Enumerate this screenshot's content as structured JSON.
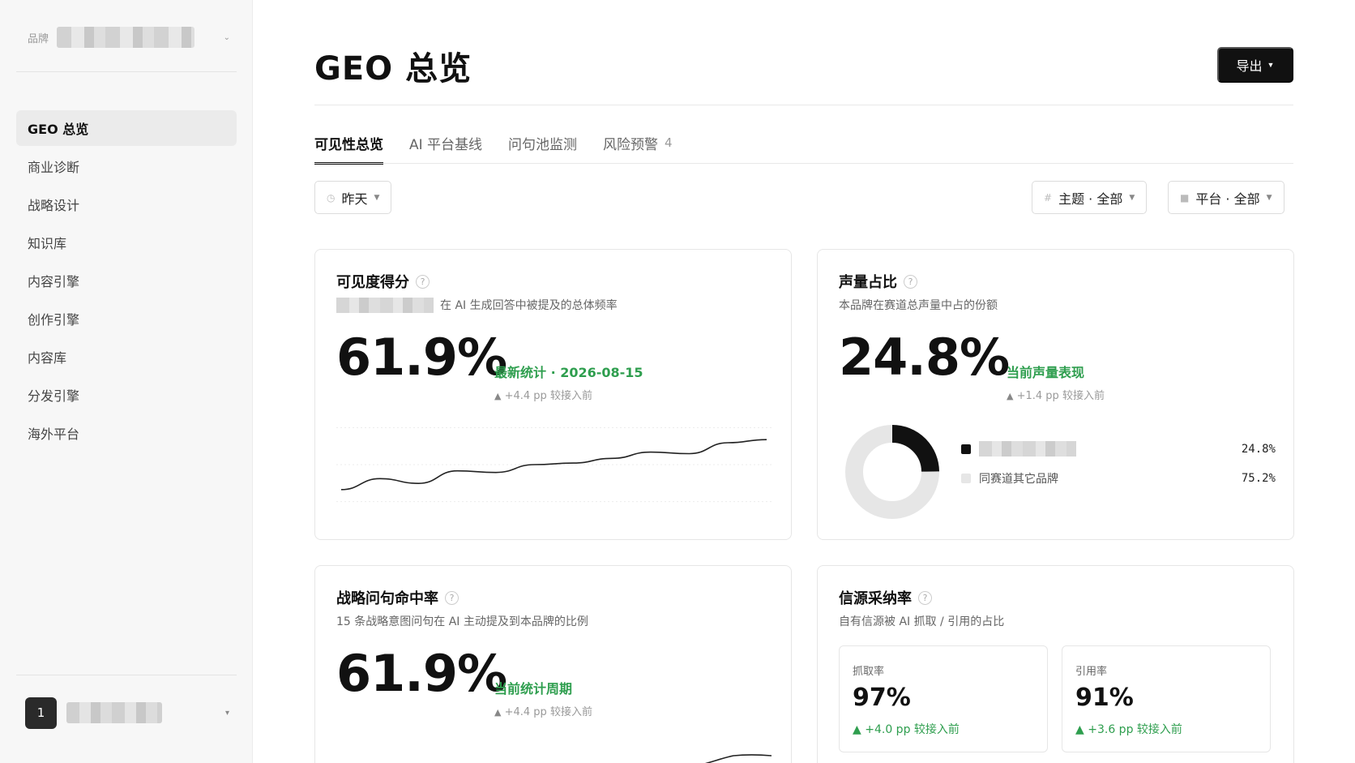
{
  "sidebar": {
    "brand_label": "品牌",
    "nav": [
      {
        "label": "GEO 总览",
        "active": true
      },
      {
        "label": "商业诊断",
        "active": false
      },
      {
        "label": "战略设计",
        "active": false
      },
      {
        "label": "知识库",
        "active": false
      },
      {
        "label": "内容引擎",
        "active": false
      },
      {
        "label": "创作引擎",
        "active": false
      },
      {
        "label": "内容库",
        "active": false
      },
      {
        "label": "分发引擎",
        "active": false
      },
      {
        "label": "海外平台",
        "active": false
      }
    ],
    "user_avatar": "1"
  },
  "header": {
    "title": "GEO 总览",
    "export_label": "导出"
  },
  "tabs": [
    {
      "label": "可见性总览",
      "active": true
    },
    {
      "label": "AI 平台基线",
      "active": false
    },
    {
      "label": "问句池监测",
      "active": false
    },
    {
      "label": "风险预警",
      "active": false,
      "count": "4"
    }
  ],
  "filters": {
    "date": "昨天",
    "topic": "主题 · 全部",
    "platform": "平台 · 全部"
  },
  "cards": {
    "visibility": {
      "title": "可见度得分",
      "subtitle": "在 AI 生成回答中被提及的总体频率",
      "value": "61.9%",
      "note": "最新统计 · 2026-08-15",
      "delta": "+4.4 pp 较接入前"
    },
    "share_of_voice": {
      "title": "声量占比",
      "subtitle": "本品牌在赛道总声量中占的份额",
      "value": "24.8%",
      "note": "当前声量表现",
      "delta": "+1.4 pp 较接入前",
      "legend": [
        {
          "label": "",
          "pct": "24.8%",
          "color": "#111111"
        },
        {
          "label": "同赛道其它品牌",
          "pct": "75.2%",
          "color": "#e6e6e6"
        }
      ]
    },
    "strategy_hit": {
      "title": "战略问句命中率",
      "subtitle": "15 条战略意图问句在 AI 主动提及到本品牌的比例",
      "value": "61.9%",
      "note": "当前统计周期",
      "delta": "+4.4 pp 较接入前"
    },
    "source_adoption": {
      "title": "信源采纳率",
      "subtitle": "自有信源被 AI 抓取 / 引用的占比",
      "metrics": [
        {
          "label": "抓取率",
          "value": "97%",
          "delta": "+4.0 pp 较接入前"
        },
        {
          "label": "引用率",
          "value": "91%",
          "delta": "+3.6 pp 较接入前"
        }
      ]
    }
  },
  "chart_data": [
    {
      "type": "line",
      "name": "visibility-trend",
      "x": [
        1,
        2,
        3,
        4,
        5,
        6,
        7,
        8,
        9,
        10,
        11,
        12
      ],
      "y": [
        52.0,
        55.5,
        54.0,
        58.0,
        57.5,
        60.0,
        60.5,
        62.0,
        64.0,
        63.5,
        67.0,
        68.0
      ],
      "ylim": [
        46,
        74
      ]
    },
    {
      "type": "pie",
      "name": "share-of-voice",
      "categories": [
        "本品牌",
        "同赛道其它品牌"
      ],
      "values": [
        24.8,
        75.2
      ]
    }
  ],
  "colors": {
    "accent": "#111111",
    "positive": "#2e9e4e",
    "muted": "#999999"
  }
}
